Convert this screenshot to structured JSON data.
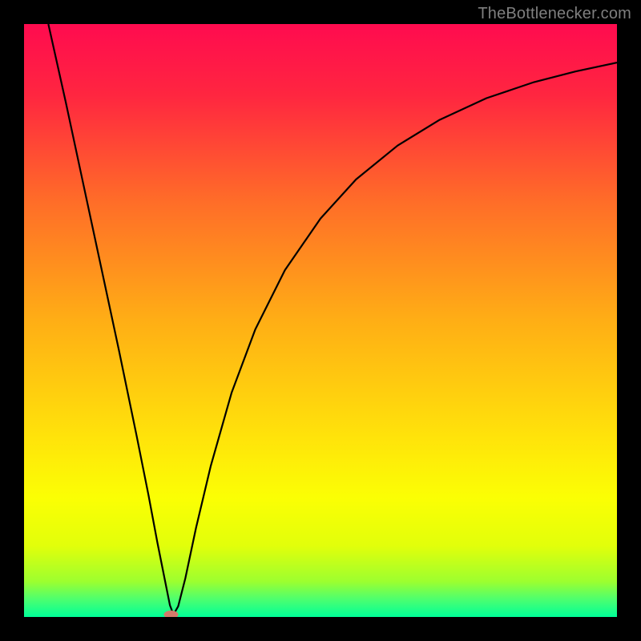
{
  "attribution": "TheBottlenecker.com",
  "chart_data": {
    "type": "line",
    "title": "",
    "xlabel": "",
    "ylabel": "",
    "xlim": [
      0,
      1
    ],
    "ylim": [
      0,
      1
    ],
    "axes_visible": false,
    "grid": false,
    "background_gradient": {
      "stops": [
        {
          "pos": 0.0,
          "color": "#ff0b4f"
        },
        {
          "pos": 0.12,
          "color": "#ff2640"
        },
        {
          "pos": 0.3,
          "color": "#ff6d28"
        },
        {
          "pos": 0.5,
          "color": "#ffae15"
        },
        {
          "pos": 0.7,
          "color": "#ffe40a"
        },
        {
          "pos": 0.8,
          "color": "#fbff04"
        },
        {
          "pos": 0.88,
          "color": "#e2ff0a"
        },
        {
          "pos": 0.94,
          "color": "#9dff2f"
        },
        {
          "pos": 0.97,
          "color": "#4dff6f"
        },
        {
          "pos": 1.0,
          "color": "#00ff99"
        }
      ]
    },
    "minimum_marker": {
      "x": 0.248,
      "y": 0.004,
      "color": "#d47a6a"
    },
    "series": [
      {
        "name": "bottleneck-curve",
        "color": "#000000",
        "width": 2.2,
        "points": [
          {
            "x": 0.041,
            "y": 1.0
          },
          {
            "x": 0.07,
            "y": 0.87
          },
          {
            "x": 0.1,
            "y": 0.73
          },
          {
            "x": 0.13,
            "y": 0.59
          },
          {
            "x": 0.16,
            "y": 0.45
          },
          {
            "x": 0.19,
            "y": 0.305
          },
          {
            "x": 0.21,
            "y": 0.205
          },
          {
            "x": 0.225,
            "y": 0.125
          },
          {
            "x": 0.238,
            "y": 0.06
          },
          {
            "x": 0.246,
            "y": 0.02
          },
          {
            "x": 0.252,
            "y": 0.004
          },
          {
            "x": 0.26,
            "y": 0.018
          },
          {
            "x": 0.272,
            "y": 0.065
          },
          {
            "x": 0.29,
            "y": 0.15
          },
          {
            "x": 0.315,
            "y": 0.255
          },
          {
            "x": 0.35,
            "y": 0.378
          },
          {
            "x": 0.39,
            "y": 0.485
          },
          {
            "x": 0.44,
            "y": 0.585
          },
          {
            "x": 0.5,
            "y": 0.672
          },
          {
            "x": 0.56,
            "y": 0.738
          },
          {
            "x": 0.63,
            "y": 0.795
          },
          {
            "x": 0.7,
            "y": 0.838
          },
          {
            "x": 0.78,
            "y": 0.875
          },
          {
            "x": 0.86,
            "y": 0.902
          },
          {
            "x": 0.93,
            "y": 0.92
          },
          {
            "x": 1.0,
            "y": 0.935
          }
        ]
      }
    ]
  }
}
